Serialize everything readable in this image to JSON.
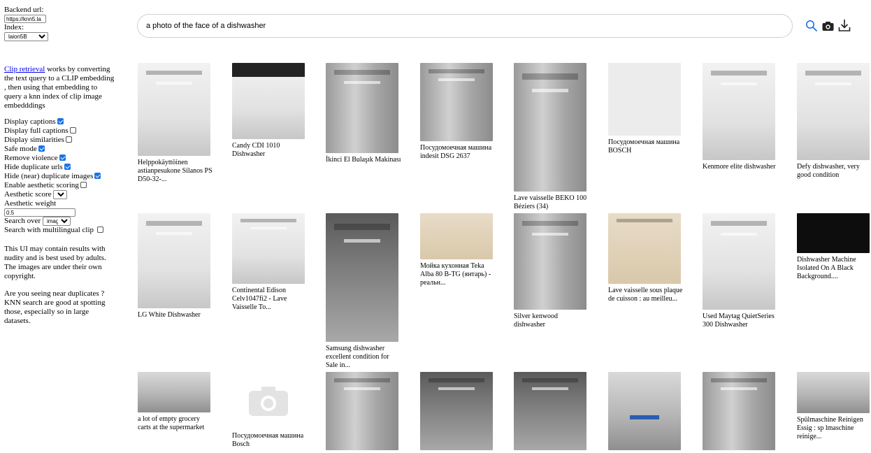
{
  "sidebar": {
    "backend_label": "Backend url:",
    "backend_value": "https://knn5.la",
    "index_label": "Index:",
    "index_value": "laion5B",
    "intro_link": "Clip retrieval",
    "intro_text": " works by converting the text query to a CLIP embedding , then using that embedding to query a knn index of clip image embedddings",
    "options": [
      {
        "label": "Display captions",
        "checked": true
      },
      {
        "label": "Display full captions",
        "checked": false
      },
      {
        "label": "Display similarities",
        "checked": false
      },
      {
        "label": "Safe mode",
        "checked": true
      },
      {
        "label": "Remove violence",
        "checked": true
      },
      {
        "label": "Hide duplicate urls",
        "checked": true
      },
      {
        "label": "Hide (near) duplicate images",
        "checked": true
      },
      {
        "label": "Enable aesthetic scoring",
        "checked": false
      }
    ],
    "aesthetic_score_label": "Aesthetic score",
    "aesthetic_score_value": "",
    "aesthetic_weight_label": "Aesthetic weight",
    "aesthetic_weight_value": "0.5",
    "search_over_label": "Search over",
    "search_over_value": "image",
    "multilingual_label": "Search with multilingual clip",
    "multilingual_checked": false,
    "warning_text": "This UI may contain results with nudity and is best used by adults. The images are under their own copyright.",
    "duplicates_text": "Are you seeing near duplicates ? KNN search are good at spotting those, especially so in large datasets."
  },
  "search": {
    "query": "a photo of the face of a dishwasher",
    "icons": [
      "search-icon",
      "camera-icon",
      "download-icon"
    ],
    "accent": "#1a73e8"
  },
  "results": {
    "row1": [
      {
        "caption": "Helppokäyttöinen astianpesukone Silanos PS D50-32-..."
      },
      {
        "caption": "Candy CDI 1010 Dishwasher"
      },
      {
        "caption": "İkinci El Bulaşık Makinası"
      },
      {
        "caption": "Посудомоечная машина indesit DSG 2637"
      },
      {
        "caption": "Lave vaisselle BEKO 100 Béziers (34)"
      },
      {
        "caption": "Посудомоечная машина BOSCH"
      },
      {
        "caption": "Kenmore elite dishwasher"
      },
      {
        "caption": "Defy dishwasher, very good condition"
      }
    ],
    "row2": [
      {
        "caption": "LG White Dishwasher"
      },
      {
        "caption": "Continental Edison Celv1047fi2 - Lave Vaisselle To..."
      },
      {
        "caption": "Samsung dishwasher excellent condition for Sale in..."
      },
      {
        "caption": "Мойка кухонная Teka Alba 80 B-TG (янтарь) - реальн..."
      },
      {
        "caption": "Silver kenwood dishwasher"
      },
      {
        "caption": "Lave vaisselle sous plaque de cuisson : au meilleu..."
      },
      {
        "caption": "Used Maytag QuietSeries 300 Dishwasher"
      },
      {
        "caption": "Dishwasher Machine Isolated On A Black Background...."
      }
    ],
    "row3": [
      {
        "caption": "a lot of empty grocery carts at the supermarket"
      },
      {
        "caption": "Посудомоечная машина Bosch"
      },
      {
        "caption": ""
      },
      {
        "caption": ""
      },
      {
        "caption": ""
      },
      {
        "caption": ""
      },
      {
        "caption": ""
      },
      {
        "caption": "Spülmaschine Reinigen Essig : sp lmaschine reinige..."
      }
    ]
  }
}
